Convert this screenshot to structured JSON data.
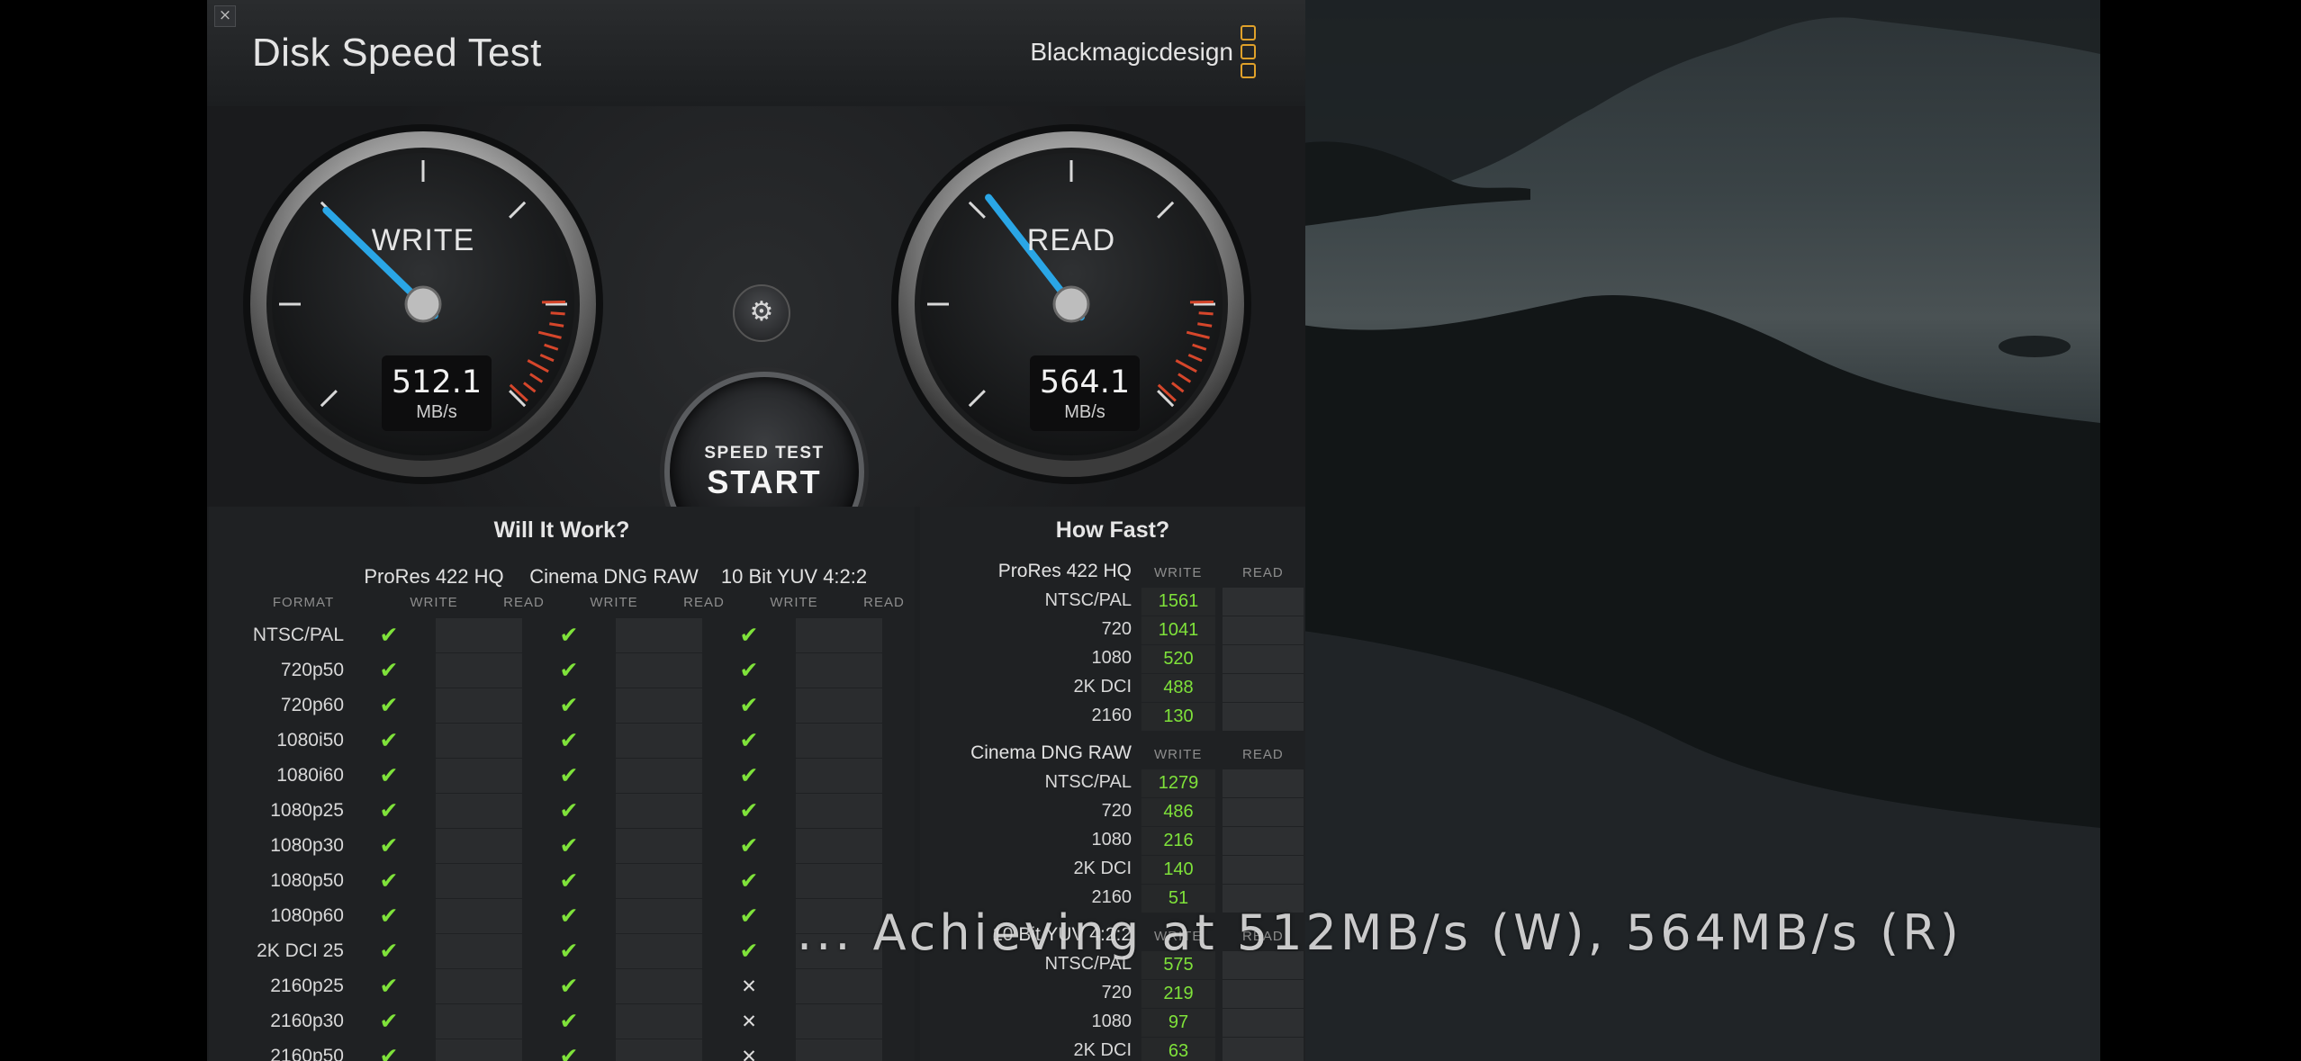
{
  "window": {
    "title": "Disk Speed Test",
    "brand": "Blackmagicdesign",
    "close_icon": "×"
  },
  "colors": {
    "check": "#7fe23a",
    "needle": "#2aa6e6",
    "redline": "#d6462b",
    "brand_logo": "#e0a12a"
  },
  "gauges": {
    "write": {
      "label": "WRITE",
      "value": "512.1",
      "unit": "MB/s",
      "level": 0.33
    },
    "read": {
      "label": "READ",
      "value": "564.1",
      "unit": "MB/s",
      "level": 0.36
    }
  },
  "controls": {
    "settings_icon": "gear-icon",
    "start_small": "SPEED TEST",
    "start_big": "START"
  },
  "will_it_work": {
    "title": "Will It Work?",
    "format_header": "FORMAT",
    "write_header": "WRITE",
    "read_header": "READ",
    "groups": [
      "ProRes 422 HQ",
      "Cinema DNG RAW",
      "10 Bit YUV 4:2:2"
    ],
    "rows": [
      {
        "format": "NTSC/PAL",
        "marks": [
          "yes",
          "yes",
          "yes"
        ]
      },
      {
        "format": "720p50",
        "marks": [
          "yes",
          "yes",
          "yes"
        ]
      },
      {
        "format": "720p60",
        "marks": [
          "yes",
          "yes",
          "yes"
        ]
      },
      {
        "format": "1080i50",
        "marks": [
          "yes",
          "yes",
          "yes"
        ]
      },
      {
        "format": "1080i60",
        "marks": [
          "yes",
          "yes",
          "yes"
        ]
      },
      {
        "format": "1080p25",
        "marks": [
          "yes",
          "yes",
          "yes"
        ]
      },
      {
        "format": "1080p30",
        "marks": [
          "yes",
          "yes",
          "yes"
        ]
      },
      {
        "format": "1080p50",
        "marks": [
          "yes",
          "yes",
          "yes"
        ]
      },
      {
        "format": "1080p60",
        "marks": [
          "yes",
          "yes",
          "yes"
        ]
      },
      {
        "format": "2K DCI 25",
        "marks": [
          "yes",
          "yes",
          "yes"
        ]
      },
      {
        "format": "2160p25",
        "marks": [
          "yes",
          "yes",
          "no"
        ]
      },
      {
        "format": "2160p30",
        "marks": [
          "yes",
          "yes",
          "no"
        ]
      },
      {
        "format": "2160p50",
        "marks": [
          "yes",
          "yes",
          "no"
        ]
      }
    ]
  },
  "how_fast": {
    "title": "How Fast?",
    "write_header": "WRITE",
    "read_header": "READ",
    "groups": [
      {
        "name": "ProRes 422 HQ",
        "rows": [
          {
            "label": "NTSC/PAL",
            "write": "1561"
          },
          {
            "label": "720",
            "write": "1041"
          },
          {
            "label": "1080",
            "write": "520"
          },
          {
            "label": "2K DCI",
            "write": "488"
          },
          {
            "label": "2160",
            "write": "130"
          }
        ]
      },
      {
        "name": "Cinema DNG RAW",
        "rows": [
          {
            "label": "NTSC/PAL",
            "write": "1279"
          },
          {
            "label": "720",
            "write": "486"
          },
          {
            "label": "1080",
            "write": "216"
          },
          {
            "label": "2K DCI",
            "write": "140"
          },
          {
            "label": "2160",
            "write": "51"
          }
        ]
      },
      {
        "name": "10 Bit YUV 4:2:2",
        "rows": [
          {
            "label": "NTSC/PAL",
            "write": "575"
          },
          {
            "label": "720",
            "write": "219"
          },
          {
            "label": "1080",
            "write": "97"
          },
          {
            "label": "2K DCI",
            "write": "63"
          }
        ]
      }
    ]
  },
  "caption": "... Achieving at 512MB/s (W), 564MB/s (R)"
}
